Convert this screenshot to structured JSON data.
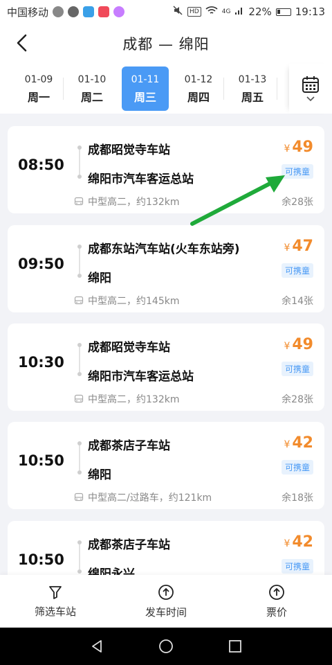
{
  "status": {
    "carrier": "中国移动",
    "hd": "HD",
    "network": "4G",
    "battery": "22%",
    "time": "19:13"
  },
  "header": {
    "title": "成都 — 绵阳"
  },
  "dates": [
    {
      "date": "01-09",
      "weekday": "周一",
      "active": false
    },
    {
      "date": "01-10",
      "weekday": "周二",
      "active": false
    },
    {
      "date": "01-11",
      "weekday": "周三",
      "active": true
    },
    {
      "date": "01-12",
      "weekday": "周四",
      "active": false
    },
    {
      "date": "01-13",
      "weekday": "周五",
      "active": false
    }
  ],
  "trips": [
    {
      "time": "08:50",
      "from": "成都昭觉寺车站",
      "to": "绵阳市汽车客运总站",
      "currency": "¥",
      "price": "49",
      "tag": "可携童",
      "info": "中型高二，约132km",
      "seats": "余28张"
    },
    {
      "time": "09:50",
      "from": "成都东站汽车站(火车东站旁)",
      "to": "绵阳",
      "currency": "¥",
      "price": "47",
      "tag": "可携童",
      "info": "中型高二，约145km",
      "seats": "余14张"
    },
    {
      "time": "10:30",
      "from": "成都昭觉寺车站",
      "to": "绵阳市汽车客运总站",
      "currency": "¥",
      "price": "49",
      "tag": "可携童",
      "info": "中型高二，约132km",
      "seats": "余28张"
    },
    {
      "time": "10:50",
      "from": "成都茶店子车站",
      "to": "绵阳",
      "currency": "¥",
      "price": "42",
      "tag": "可携童",
      "info": "中型高二/过路车，约121km",
      "seats": "余18张"
    },
    {
      "time": "10:50",
      "from": "成都茶店子车站",
      "to": "绵阳永兴",
      "currency": "¥",
      "price": "42",
      "tag": "可携童",
      "info": "",
      "seats": ""
    }
  ],
  "bottom": {
    "filter_label": "筛选车站",
    "departure_label": "发车时间",
    "price_label": "票价"
  },
  "colors": {
    "accent": "#4a9af5",
    "price": "#f28b2c",
    "annotation": "#1faa3a"
  }
}
